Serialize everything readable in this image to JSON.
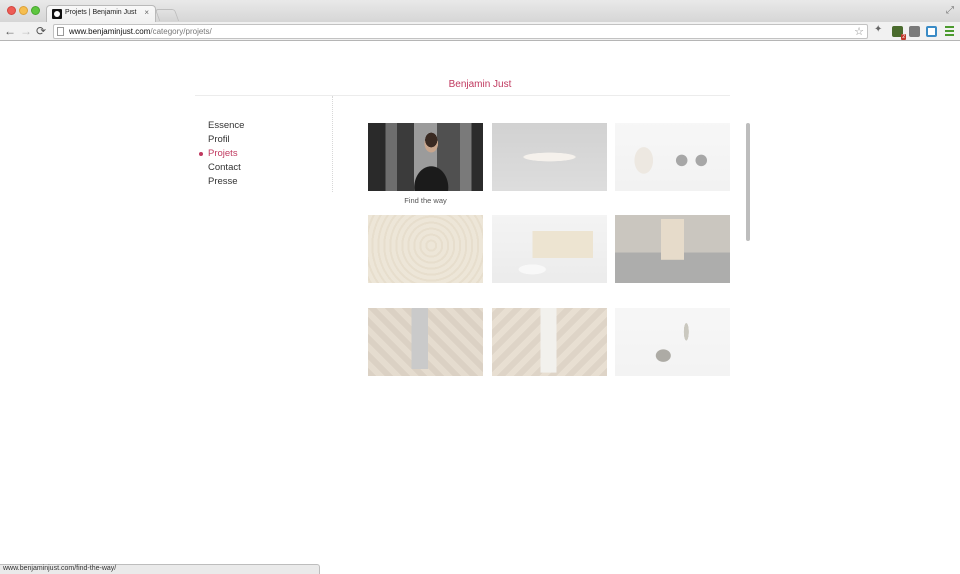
{
  "browser": {
    "tab_title": "Projets | Benjamin Just",
    "tab_close": "×",
    "url_host": "www.benjaminjust.com",
    "url_path": "/category/projets/",
    "status_url": "www.benjaminjust.com/find-the-way/",
    "icons": {
      "back": "←",
      "forward": "→",
      "reload": "⟳",
      "star": "☆",
      "fullscreen": "⤢",
      "extension": "✦",
      "badge": "2"
    }
  },
  "site": {
    "title": "Benjamin Just",
    "accent_color": "#c0395f",
    "nav": [
      {
        "label": "Essence"
      },
      {
        "label": "Profil"
      },
      {
        "label": "Projets",
        "active": true
      },
      {
        "label": "Contact"
      },
      {
        "label": "Presse"
      }
    ]
  },
  "projects": [
    {
      "caption": "Find the way",
      "hovered": true,
      "icon": "person-drawing-photo"
    },
    {
      "caption": "",
      "icon": "ribbed-curved-object-photo"
    },
    {
      "caption": "",
      "icon": "cup-and-headphones-photo"
    },
    {
      "caption": "",
      "icon": "wood-rings-photo"
    },
    {
      "caption": "",
      "icon": "wooden-block-and-curve-photo"
    },
    {
      "caption": "",
      "icon": "wooden-stool-photo"
    },
    {
      "caption": "",
      "icon": "folded-panel-on-parquet-photo"
    },
    {
      "caption": "",
      "icon": "tall-sculpture-on-parquet-photo"
    },
    {
      "caption": "",
      "icon": "stone-object-photo"
    }
  ]
}
